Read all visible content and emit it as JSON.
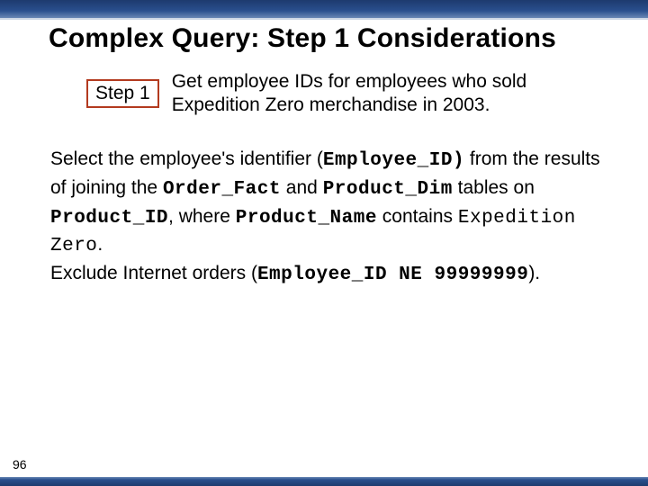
{
  "title": "Complex Query: Step 1 Considerations",
  "step": {
    "label": "Step 1",
    "desc_line1": "Get employee IDs for employees who sold",
    "desc_line2": "Expedition Zero merchandise in 2003."
  },
  "body": {
    "p1a": "Select the employee's identifier (",
    "code_empid": "Employee_ID)",
    "p1b": " from the results of joining the ",
    "code_orderfact": "Order_Fact",
    "p1c": " and ",
    "code_productdim": "Product_Dim",
    "p1d": " tables on ",
    "code_productid": "Product_ID",
    "p1e": ", where ",
    "code_productname": "Product_Name",
    "p1f": " contains ",
    "code_expzero": "Expedition Zero",
    "p1g": ".",
    "p2a": "Exclude Internet orders (",
    "code_empid_ne": "Employee_ID NE 99999999",
    "p2b": ")."
  },
  "page_number": "96"
}
